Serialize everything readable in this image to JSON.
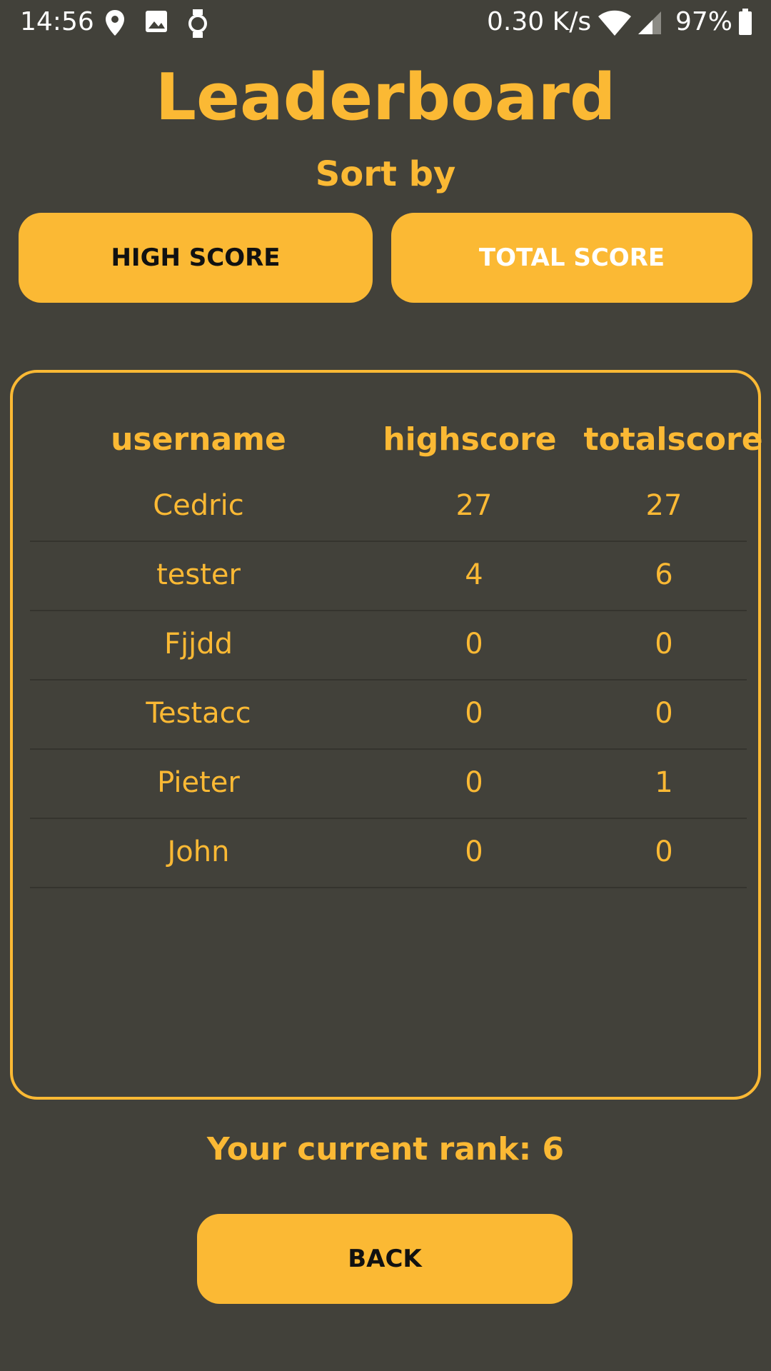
{
  "status_bar": {
    "time": "14:56",
    "net_speed": "0.30 K/s",
    "battery": "97%",
    "icons": [
      "location-icon",
      "image-icon",
      "watch-icon",
      "wifi-icon",
      "signal-icon",
      "battery-icon"
    ]
  },
  "title": "Leaderboard",
  "sort": {
    "label": "Sort by",
    "buttons": {
      "high_score": "HIGH SCORE",
      "total_score": "TOTAL SCORE"
    }
  },
  "table": {
    "headers": [
      "username",
      "highscore",
      "totalscore"
    ],
    "rows": [
      [
        "Cedric",
        "27",
        "27"
      ],
      [
        "tester",
        "4",
        "6"
      ],
      [
        "Fjjdd",
        "0",
        "0"
      ],
      [
        "Testacc",
        "0",
        "0"
      ],
      [
        "Pieter",
        "0",
        "1"
      ],
      [
        "John",
        "0",
        "0"
      ]
    ]
  },
  "rank_text": "Your current rank: 6",
  "back_label": "BACK",
  "colors": {
    "background": "#42413a",
    "accent": "#fbb934",
    "dark_text": "#111111",
    "light_text": "#ffffff"
  }
}
